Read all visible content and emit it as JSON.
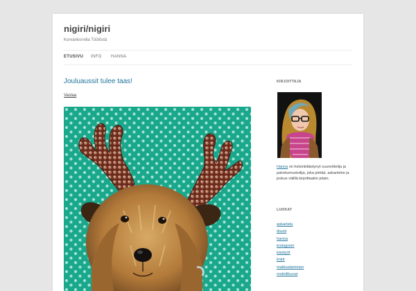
{
  "site": {
    "title": "nigiri/nigiri",
    "description": "Korvankorvilla Töölöstä"
  },
  "nav": {
    "items": [
      {
        "label": "ETUSIVU",
        "active": true
      },
      {
        "label": "INFO",
        "active": false
      },
      {
        "label": "HANNA",
        "active": false
      }
    ]
  },
  "post": {
    "title": "Jouluaussit tulee taas!",
    "reply_label": "Vastaa",
    "image_alt": "dog wearing reindeer antlers"
  },
  "sidebar": {
    "author_heading": "KIRJOITTAJA",
    "bio_link": "Hanna",
    "bio_text": " on helsinkiläistynyt suunnittelija ja palvelumuotoilija, joka piirtää, askartelee ja joskus välillä kirjoittaakin jotain.",
    "categories_heading": "LUOKAT",
    "categories": [
      "askartelu",
      "duuni",
      "hanna",
      "instagram",
      "käsityöt",
      "linkit",
      "matkustaminen",
      "mobiilikuvat"
    ]
  },
  "colors": {
    "link": "#21759b",
    "background": "#e6e6e6",
    "photo_background": "#1aa88c"
  }
}
